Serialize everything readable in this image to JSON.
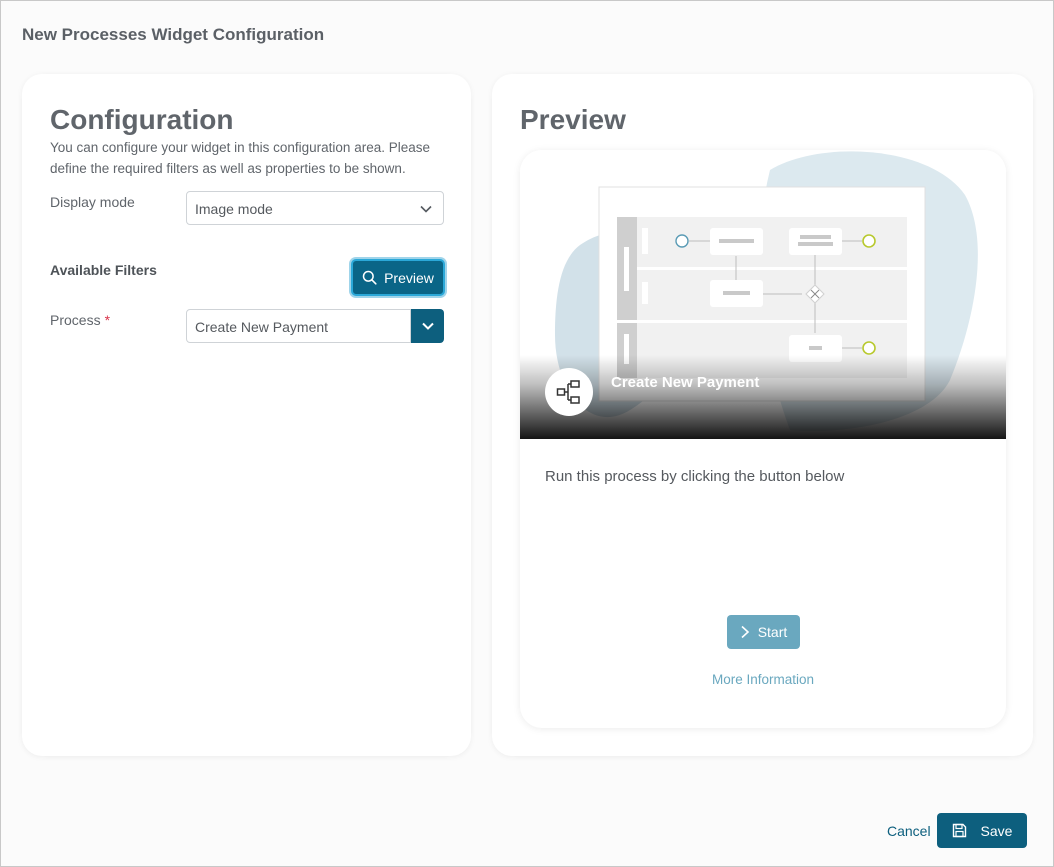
{
  "dialog": {
    "title": "New Processes Widget Configuration"
  },
  "configuration": {
    "title": "Configuration",
    "description": "You can configure your widget in this configuration area. Please define the required filters as well as properties to be shown.",
    "display_mode_label": "Display mode",
    "display_mode_value": "Image mode",
    "filters_title": "Available Filters",
    "preview_button": "Preview",
    "process_label": "Process",
    "process_required_marker": "*",
    "process_value": "Create New Payment"
  },
  "preview": {
    "title": "Preview",
    "card": {
      "process_title": "Create New Payment",
      "description": "Run this process by clicking the button below",
      "start_button": "Start",
      "more_info_link": "More Information"
    }
  },
  "footer": {
    "cancel_label": "Cancel",
    "save_label": "Save"
  },
  "colors": {
    "primary": "#0d5f7e",
    "accent_light": "#6aa8bf",
    "required": "#d9334a",
    "text": "#60656b"
  },
  "icons": {
    "preview": "search-icon",
    "dropdown": "chevron-down-icon",
    "process": "process-flow-icon",
    "start": "chevron-right-icon",
    "save": "floppy-disk-icon"
  }
}
